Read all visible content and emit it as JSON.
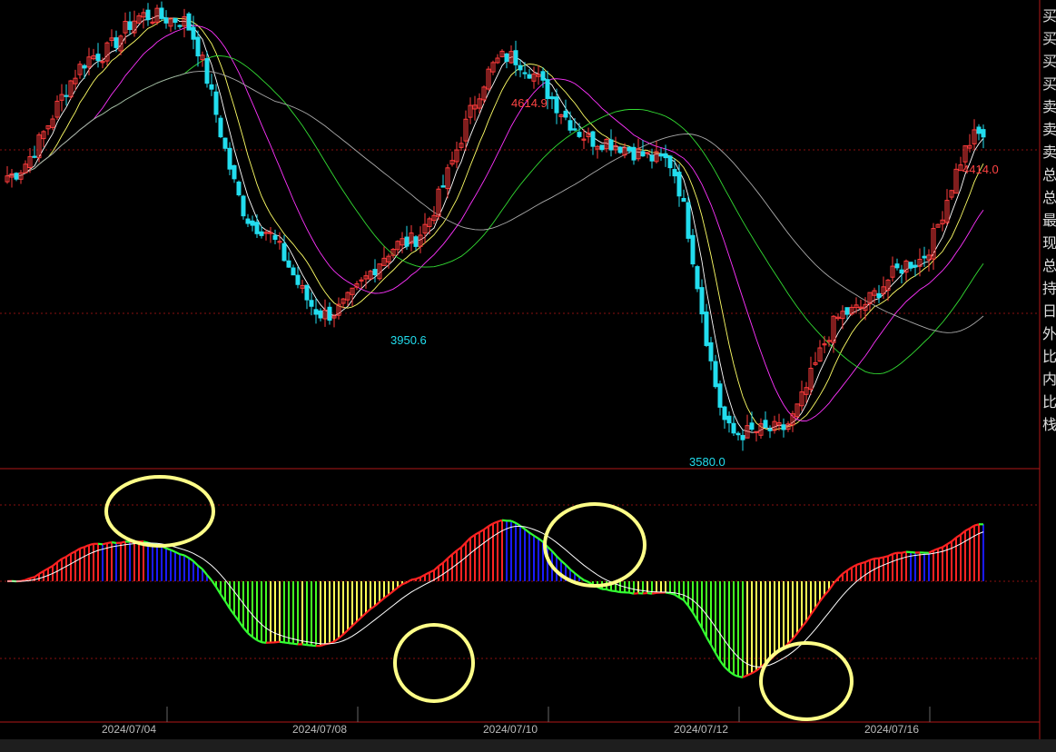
{
  "chart_data": {
    "type": "candlestick",
    "title": "",
    "price_range": [
      3560,
      4760
    ],
    "high_label": 4614.9,
    "low_label": 3950.6,
    "right_high_label": 4414.0,
    "bottom_low_label": 3580.0,
    "dates": [
      "2024/07/04",
      "2024/07/08",
      "2024/07/10",
      "2024/07/12",
      "2024/07/16"
    ],
    "ohlc_approx": [
      {
        "bar": 0,
        "close": 4310
      },
      {
        "bar": 20,
        "close": 4620
      },
      {
        "bar": 30,
        "close": 4720
      },
      {
        "bar": 38,
        "close": 4710
      },
      {
        "bar": 55,
        "close": 4180
      },
      {
        "bar": 70,
        "close": 3955
      },
      {
        "bar": 88,
        "close": 4140
      },
      {
        "bar": 110,
        "close": 4615
      },
      {
        "bar": 130,
        "close": 4400
      },
      {
        "bar": 145,
        "close": 4350
      },
      {
        "bar": 160,
        "close": 3650
      },
      {
        "bar": 170,
        "close": 3660
      },
      {
        "bar": 185,
        "close": 3960
      },
      {
        "bar": 200,
        "close": 4090
      },
      {
        "bar": 214,
        "close": 4414
      }
    ],
    "ma_series": [
      "white",
      "yellow",
      "magenta",
      "green",
      "gray"
    ],
    "indicator": {
      "type": "macd-histogram",
      "colors": {
        "positive_rising": "#ff2222",
        "positive_falling": "#1a1aff",
        "negative_falling": "#44ff22",
        "negative_rising": "#ffff55"
      }
    },
    "annotations": {
      "highlight_circles": 4,
      "color": "#ffff88"
    }
  },
  "colors": {
    "up": "#ff3b3b",
    "down": "#22ddee",
    "grid": "#8a1010",
    "background": "#000000"
  },
  "side_labels": [
    "买",
    "买",
    "买",
    "买",
    "卖",
    "卖",
    "卖",
    "总",
    "总",
    "最",
    "现",
    "总",
    "持",
    "日",
    "外",
    "比",
    "内",
    "比",
    "栈"
  ]
}
